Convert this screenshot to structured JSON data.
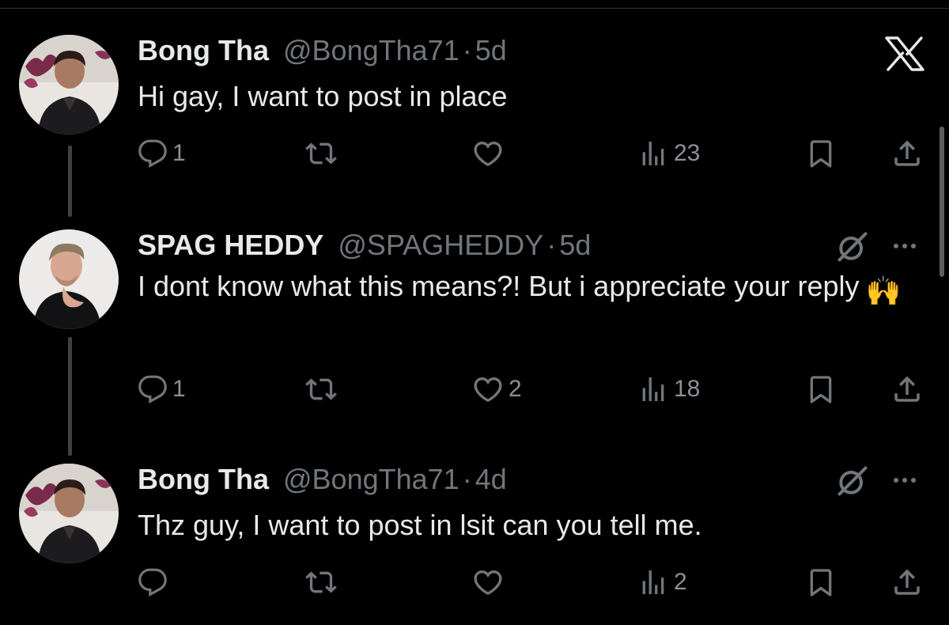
{
  "posts": [
    {
      "name": "Bong Tha",
      "handle": "@BongTha71",
      "separator": "·",
      "time": "5d",
      "text": "Hi gay, I want to post in place",
      "emoji": "",
      "counts": {
        "replies": "1",
        "reposts": "",
        "likes": "",
        "views": "23"
      },
      "avatar": "bong-tha-avatar"
    },
    {
      "name": "SPAG HEDDY",
      "handle": "@SPAGHEDDY",
      "separator": "·",
      "time": "5d",
      "text": "I dont know what this means?! But i appreciate your reply",
      "emoji": "🙌",
      "counts": {
        "replies": "1",
        "reposts": "",
        "likes": "2",
        "views": "18"
      },
      "avatar": "spag-heddy-avatar"
    },
    {
      "name": "Bong Tha",
      "handle": "@BongTha71",
      "separator": "·",
      "time": "4d",
      "text": "Thz guy, I want to post in lsit can you tell me.",
      "emoji": "",
      "counts": {
        "replies": "",
        "reposts": "",
        "likes": "",
        "views": "2"
      },
      "avatar": "bong-tha-avatar"
    }
  ],
  "icons": {
    "logo": "x-logo-icon",
    "reply": "reply-icon",
    "repost": "repost-icon",
    "like": "heart-icon",
    "views": "views-icon",
    "bookmark": "bookmark-icon",
    "share": "share-icon",
    "grok": "grok-icon",
    "more": "more-icon"
  },
  "colors": {
    "background": "#000000",
    "primary_text": "#e7e9ea",
    "secondary_text": "#71767b",
    "thread_line": "#3e4144"
  }
}
